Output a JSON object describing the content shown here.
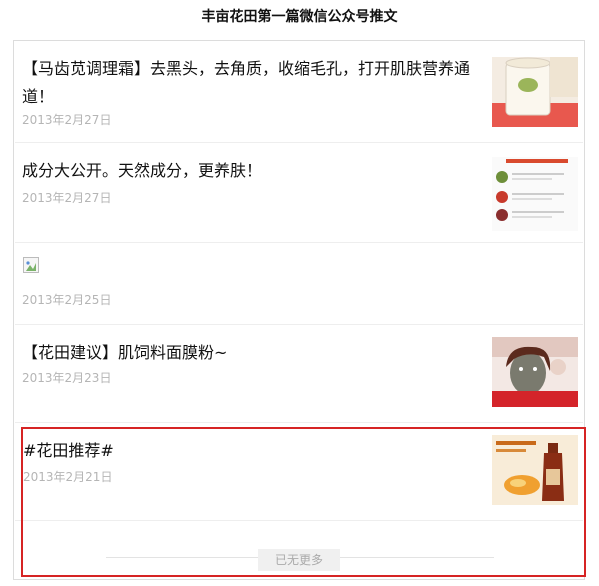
{
  "page": {
    "title": "丰亩花田第一篇微信公众号推文"
  },
  "articles": [
    {
      "title": "【马齿苋调理霜】去黑头，去角质，收缩毛孔，打开肌肤营养通道！",
      "date": "2013年2月27日",
      "thumbnail": "cream-jar"
    },
    {
      "title": "成分大公开。天然成分，更养肤！",
      "date": "2013年2月27日",
      "thumbnail": "ingredients-sheet"
    },
    {
      "title": "",
      "date": "2013年2月25日",
      "thumbnail": "broken-image"
    },
    {
      "title": "【花田建议】肌饲料面膜粉~",
      "date": "2013年2月23日",
      "thumbnail": "face-mask-woman"
    },
    {
      "title": "#花田推荐#",
      "date": "2013年2月21日",
      "thumbnail": "serum-bottle"
    }
  ],
  "footer": {
    "more_label": "已无更多"
  },
  "colors": {
    "highlight_border": "#d62424",
    "date_text": "#b5b5b5"
  }
}
